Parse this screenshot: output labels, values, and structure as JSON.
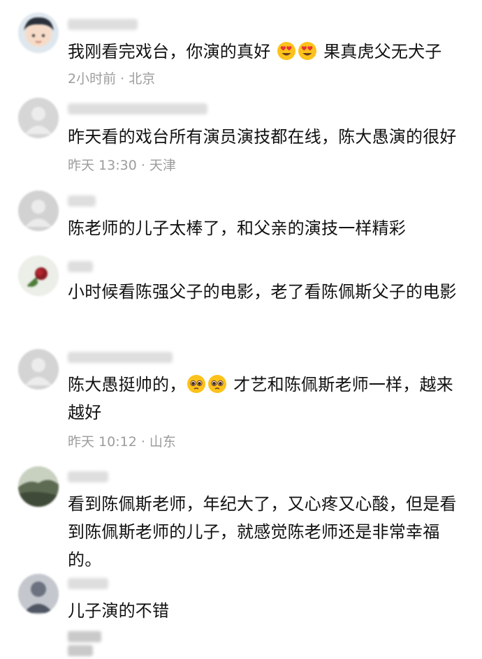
{
  "comments": [
    {
      "text_a": "我刚看完戏台，你演的真好",
      "emoji": [
        "heart-eyes",
        "heart-eyes"
      ],
      "text_b": "果真虎父无犬子",
      "meta": "2小时前 · 北京"
    },
    {
      "text": "昨天看的戏台所有演员演技都在线，陈大愚演的很好",
      "meta": "昨天 13:30 · 天津"
    },
    {
      "text": "陈老师的儿子太棒了，和父亲的演技一样精彩"
    },
    {
      "text": "小时候看陈强父子的电影，老了看陈佩斯父子的电影"
    },
    {
      "text_a": "陈大愚挺帅的，",
      "emoji": [
        "pleading-face",
        "pleading-face"
      ],
      "text_b": "才艺和陈佩斯老师一样，越来越好",
      "meta": "昨天 10:12 · 山东"
    },
    {
      "text": "看到陈佩斯老师，年纪大了，又心疼又心酸，但是看到陈佩斯老师的儿子，就感觉陈老师还是非常幸福的。"
    },
    {
      "text": "儿子演的不错"
    }
  ],
  "colors": {
    "background": "#ffffff",
    "comment_text": "#111111",
    "meta_text": "#9c9c9c",
    "blurred_placeholder": "#dedede"
  }
}
